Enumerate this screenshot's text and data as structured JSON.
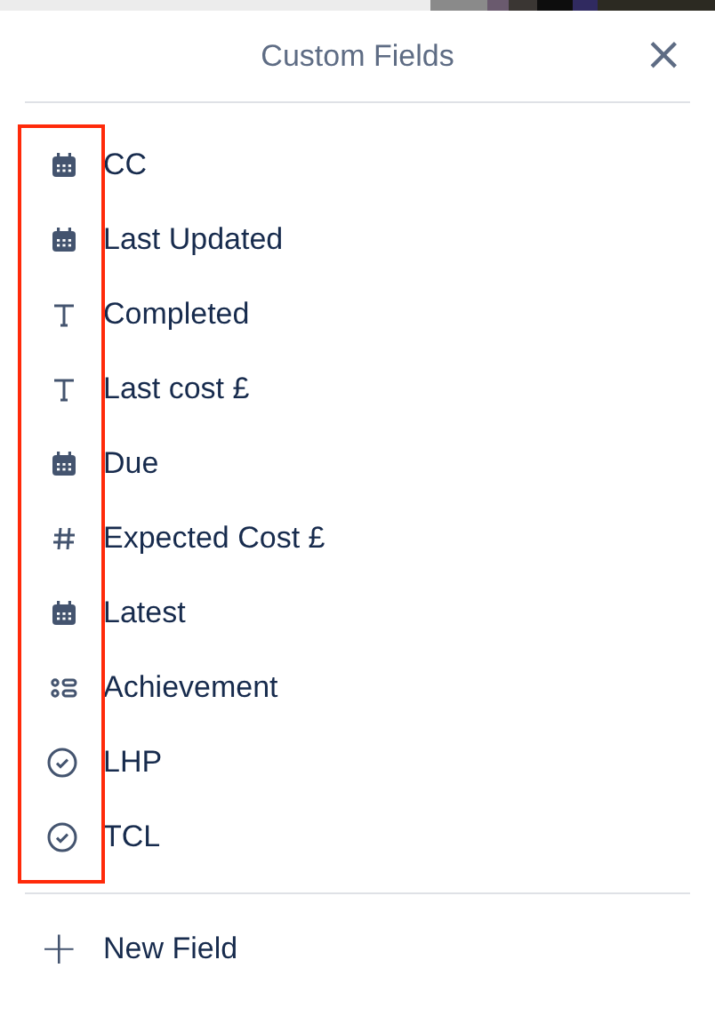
{
  "popover": {
    "title": "Custom Fields",
    "close": "×"
  },
  "fields": [
    {
      "kind": "date",
      "label": "CC"
    },
    {
      "kind": "date",
      "label": "Last Updated"
    },
    {
      "kind": "text",
      "label": "Completed"
    },
    {
      "kind": "text",
      "label": "Last cost £"
    },
    {
      "kind": "date",
      "label": "Due"
    },
    {
      "kind": "number",
      "label": "Expected Cost £"
    },
    {
      "kind": "date",
      "label": "Latest"
    },
    {
      "kind": "dropdown",
      "label": "Achievement"
    },
    {
      "kind": "checkbox",
      "label": "LHP"
    },
    {
      "kind": "checkbox",
      "label": "TCL"
    }
  ],
  "new_field": {
    "icon": "+",
    "label": "New Field"
  }
}
